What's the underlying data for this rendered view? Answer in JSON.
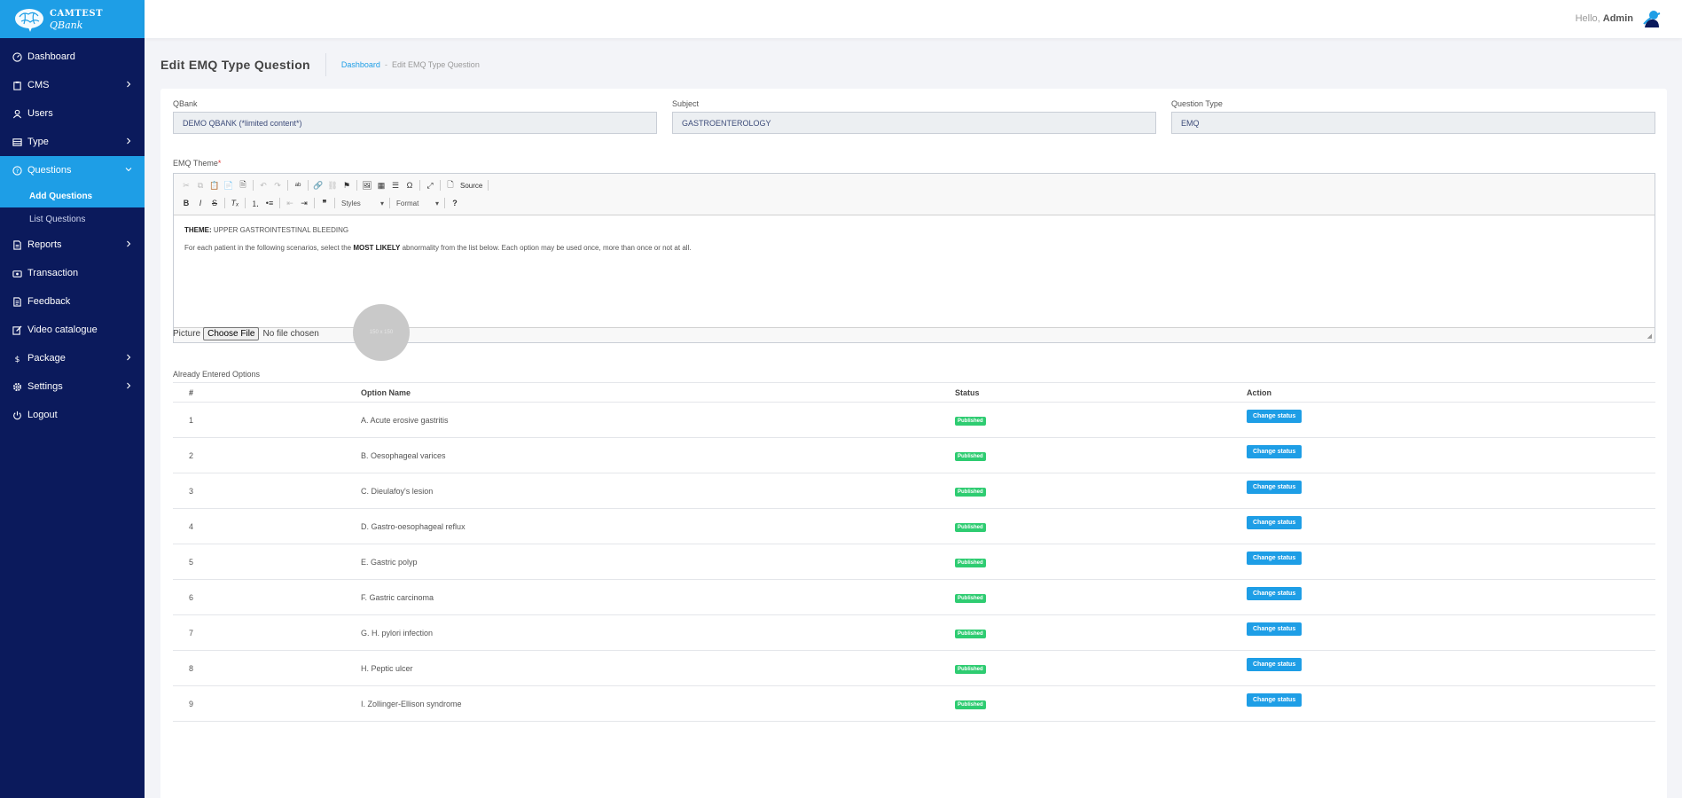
{
  "brand": {
    "line1": "CAMTEST",
    "line2": "QBank"
  },
  "topbar": {
    "hello": "Hello,",
    "user": "Admin"
  },
  "sidebar": {
    "items": [
      {
        "label": "Dashboard",
        "icon": "dashboard-icon",
        "has_children": false
      },
      {
        "label": "CMS",
        "icon": "clipboard-icon",
        "has_children": true
      },
      {
        "label": "Users",
        "icon": "user-icon",
        "has_children": false
      },
      {
        "label": "Type",
        "icon": "list-icon",
        "has_children": true
      },
      {
        "label": "Questions",
        "icon": "question-icon",
        "has_children": true,
        "expanded": true,
        "children": [
          {
            "label": "Add Questions",
            "active": true
          },
          {
            "label": "List Questions",
            "active": false
          }
        ]
      },
      {
        "label": "Reports",
        "icon": "report-icon",
        "has_children": true
      },
      {
        "label": "Transaction",
        "icon": "transaction-icon",
        "has_children": false
      },
      {
        "label": "Feedback",
        "icon": "feedback-icon",
        "has_children": false
      },
      {
        "label": "Video catalogue",
        "icon": "edit-icon",
        "has_children": false
      },
      {
        "label": "Package",
        "icon": "dollar-icon",
        "has_children": true
      },
      {
        "label": "Settings",
        "icon": "gear-icon",
        "has_children": true
      },
      {
        "label": "Logout",
        "icon": "power-icon",
        "has_children": false
      }
    ]
  },
  "page": {
    "title": "Edit EMQ Type Question",
    "breadcrumb_link": "Dashboard",
    "breadcrumb_sep": "-",
    "breadcrumb_current": "Edit EMQ Type Question"
  },
  "form": {
    "qbank": {
      "label": "QBank",
      "value": "DEMO QBANK (*limited content*)"
    },
    "subject": {
      "label": "Subject",
      "value": "GASTROENTEROLOGY"
    },
    "question_type": {
      "label": "Question Type",
      "value": "EMQ"
    },
    "emq_theme_label": "EMQ Theme",
    "required_mark": "*",
    "editor": {
      "source_label": "Source",
      "styles_label": "Styles",
      "format_label": "Format",
      "theme_bold": "THEME:",
      "theme_text": " UPPER GASTROINTESTINAL BLEEDING",
      "instr_pre": "For each patient in the following scenarios, select the ",
      "instr_bold": "MOST LIKELY",
      "instr_post": " abnormality from the list below. Each option may be used once, more than once or not at all."
    },
    "picture_label": "Picture",
    "choose_file": "Choose File",
    "no_file": "No file chosen",
    "preview_text": "150 x 150"
  },
  "options": {
    "title": "Already Entered Options",
    "columns": [
      "#",
      "Option Name",
      "Status",
      "Action"
    ],
    "rows": [
      {
        "num": "1",
        "name": "A. Acute erosive gastritis",
        "status": "Published",
        "action": "Change status"
      },
      {
        "num": "2",
        "name": "B. Oesophageal varices",
        "status": "Published",
        "action": "Change status"
      },
      {
        "num": "3",
        "name": "C. Dieulafoy's lesion",
        "status": "Published",
        "action": "Change status"
      },
      {
        "num": "4",
        "name": "D. Gastro-oesophageal reflux",
        "status": "Published",
        "action": "Change status"
      },
      {
        "num": "5",
        "name": "E. Gastric polyp",
        "status": "Published",
        "action": "Change status"
      },
      {
        "num": "6",
        "name": "F. Gastric carcinoma",
        "status": "Published",
        "action": "Change status"
      },
      {
        "num": "7",
        "name": "G. H. pylori infection",
        "status": "Published",
        "action": "Change status"
      },
      {
        "num": "8",
        "name": "H. Peptic ulcer",
        "status": "Published",
        "action": "Change status"
      },
      {
        "num": "9",
        "name": "I. Zollinger-Ellison syndrome",
        "status": "Published",
        "action": "Change status"
      }
    ]
  },
  "colors": {
    "sidebar_bg": "#0b1a5c",
    "accent": "#1e9ee6",
    "published": "#2ecc71"
  }
}
